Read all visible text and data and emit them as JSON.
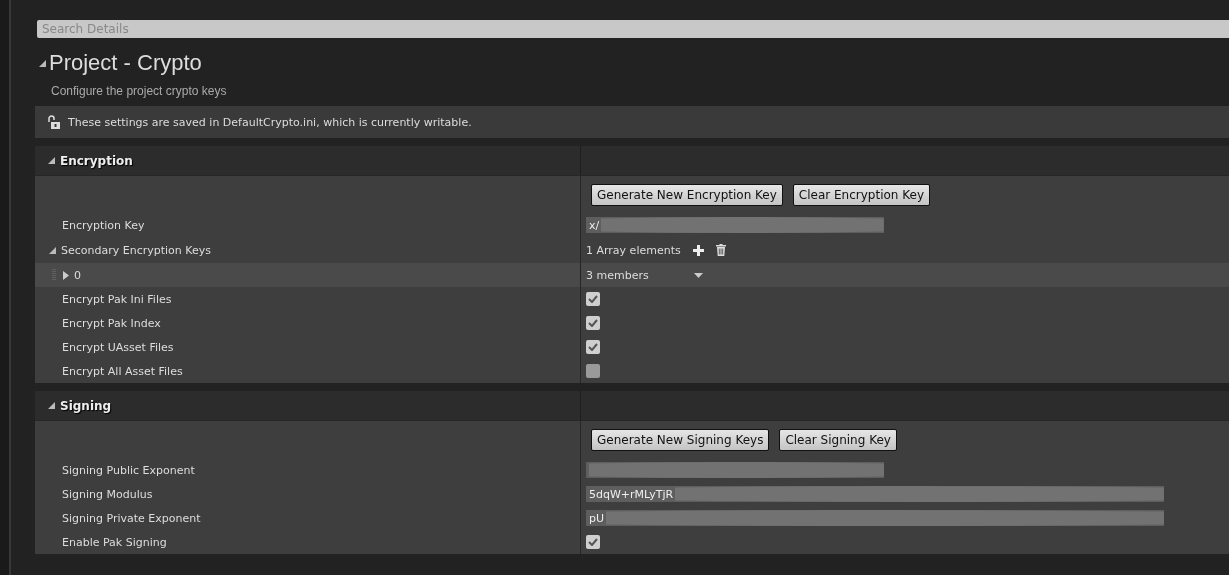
{
  "search": {
    "placeholder": "Search Details"
  },
  "title": "Project - Crypto",
  "subtitle": "Configure the project crypto keys",
  "notice": "These settings are saved in DefaultCrypto.ini, which is currently writable.",
  "sections": [
    {
      "title": "Encryption",
      "expanded": true,
      "rows": [
        {
          "kind": "buttons",
          "buttons": [
            "Generate New Encryption Key",
            "Clear Encryption Key"
          ]
        },
        {
          "kind": "text",
          "label": "Encryption Key",
          "value": "x/",
          "redacted": true
        },
        {
          "kind": "array",
          "label": "Secondary Encryption Keys",
          "expanded": true,
          "value": "1 Array elements"
        },
        {
          "kind": "struct",
          "label": "0",
          "expanded": false,
          "value": "3 members"
        },
        {
          "kind": "checkbox",
          "label": "Encrypt Pak Ini Files",
          "checked": true
        },
        {
          "kind": "checkbox",
          "label": "Encrypt Pak Index",
          "checked": true
        },
        {
          "kind": "checkbox",
          "label": "Encrypt UAsset Files",
          "checked": true
        },
        {
          "kind": "checkbox",
          "label": "Encrypt All Asset Files",
          "checked": false
        }
      ]
    },
    {
      "title": "Signing",
      "expanded": true,
      "rows": [
        {
          "kind": "buttons",
          "buttons": [
            "Generate New Signing Keys",
            "Clear Signing Key"
          ]
        },
        {
          "kind": "text",
          "label": "Signing Public Exponent",
          "value": "",
          "redacted": true
        },
        {
          "kind": "text",
          "label": "Signing Modulus",
          "value": "5dqW+rMLyTjR",
          "redacted": true
        },
        {
          "kind": "text",
          "label": "Signing Private Exponent",
          "value": "pU",
          "redacted": true
        },
        {
          "kind": "checkbox",
          "label": "Enable Pak Signing",
          "checked": true
        }
      ]
    }
  ]
}
